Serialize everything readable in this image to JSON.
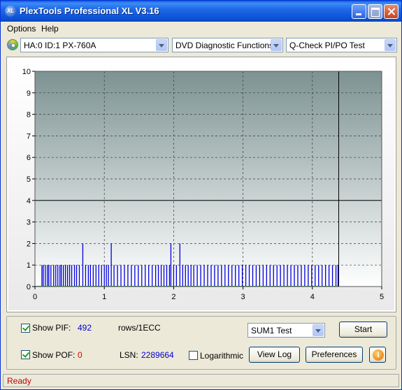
{
  "window": {
    "title": "PlexTools Professional XL V3.16",
    "app_icon_text": "XL"
  },
  "menu": {
    "items": [
      "Options",
      "Help"
    ]
  },
  "toolbar": {
    "drive_select": "HA:0 ID:1  PX-760A",
    "function_select": "DVD Diagnostic Functions",
    "test_select": "Q-Check PI/PO Test"
  },
  "chart_data": {
    "type": "bar",
    "xlim": [
      0,
      5
    ],
    "ylim": [
      0,
      10
    ],
    "x_ticks": [
      "0",
      "1",
      "2",
      "3",
      "4",
      "5"
    ],
    "y_ticks": [
      "0",
      "1",
      "2",
      "3",
      "4",
      "5",
      "6",
      "7",
      "8",
      "9",
      "10"
    ],
    "grid": true,
    "threshold_line_y": 4,
    "end_marker_x": 4.38,
    "colors": {
      "bars": "#0000dd",
      "area_top": "#7d9292",
      "area_bottom": "#ffffff",
      "threshold": "#000000"
    },
    "series": [
      {
        "values": [
          {
            "x": 0.1,
            "y": 1
          },
          {
            "x": 0.12,
            "y": 1
          },
          {
            "x": 0.15,
            "y": 1
          },
          {
            "x": 0.18,
            "y": 1
          },
          {
            "x": 0.2,
            "y": 1
          },
          {
            "x": 0.23,
            "y": 1
          },
          {
            "x": 0.27,
            "y": 1
          },
          {
            "x": 0.3,
            "y": 1
          },
          {
            "x": 0.33,
            "y": 1
          },
          {
            "x": 0.36,
            "y": 1
          },
          {
            "x": 0.38,
            "y": 1
          },
          {
            "x": 0.41,
            "y": 1
          },
          {
            "x": 0.44,
            "y": 1
          },
          {
            "x": 0.47,
            "y": 1
          },
          {
            "x": 0.5,
            "y": 1
          },
          {
            "x": 0.53,
            "y": 1
          },
          {
            "x": 0.57,
            "y": 1
          },
          {
            "x": 0.6,
            "y": 1
          },
          {
            "x": 0.64,
            "y": 1
          },
          {
            "x": 0.69,
            "y": 2
          },
          {
            "x": 0.73,
            "y": 1
          },
          {
            "x": 0.77,
            "y": 1
          },
          {
            "x": 0.8,
            "y": 1
          },
          {
            "x": 0.84,
            "y": 1
          },
          {
            "x": 0.88,
            "y": 1
          },
          {
            "x": 0.92,
            "y": 1
          },
          {
            "x": 0.96,
            "y": 1
          },
          {
            "x": 1.0,
            "y": 1
          },
          {
            "x": 1.03,
            "y": 1
          },
          {
            "x": 1.06,
            "y": 1
          },
          {
            "x": 1.1,
            "y": 2
          },
          {
            "x": 1.14,
            "y": 1
          },
          {
            "x": 1.19,
            "y": 1
          },
          {
            "x": 1.24,
            "y": 1
          },
          {
            "x": 1.29,
            "y": 1
          },
          {
            "x": 1.34,
            "y": 1
          },
          {
            "x": 1.39,
            "y": 1
          },
          {
            "x": 1.44,
            "y": 1
          },
          {
            "x": 1.49,
            "y": 1
          },
          {
            "x": 1.54,
            "y": 1
          },
          {
            "x": 1.59,
            "y": 1
          },
          {
            "x": 1.64,
            "y": 1
          },
          {
            "x": 1.69,
            "y": 1
          },
          {
            "x": 1.74,
            "y": 1
          },
          {
            "x": 1.78,
            "y": 1
          },
          {
            "x": 1.82,
            "y": 1
          },
          {
            "x": 1.86,
            "y": 1
          },
          {
            "x": 1.9,
            "y": 1
          },
          {
            "x": 1.94,
            "y": 1
          },
          {
            "x": 1.96,
            "y": 2
          },
          {
            "x": 2.0,
            "y": 1
          },
          {
            "x": 2.04,
            "y": 1
          },
          {
            "x": 2.09,
            "y": 2
          },
          {
            "x": 2.13,
            "y": 1
          },
          {
            "x": 2.17,
            "y": 1
          },
          {
            "x": 2.21,
            "y": 1
          },
          {
            "x": 2.25,
            "y": 1
          },
          {
            "x": 2.29,
            "y": 1
          },
          {
            "x": 2.34,
            "y": 1
          },
          {
            "x": 2.39,
            "y": 1
          },
          {
            "x": 2.44,
            "y": 1
          },
          {
            "x": 2.49,
            "y": 1
          },
          {
            "x": 2.54,
            "y": 1
          },
          {
            "x": 2.59,
            "y": 1
          },
          {
            "x": 2.64,
            "y": 1
          },
          {
            "x": 2.69,
            "y": 1
          },
          {
            "x": 2.74,
            "y": 1
          },
          {
            "x": 2.79,
            "y": 1
          },
          {
            "x": 2.84,
            "y": 1
          },
          {
            "x": 2.89,
            "y": 1
          },
          {
            "x": 2.94,
            "y": 1
          },
          {
            "x": 2.99,
            "y": 1
          },
          {
            "x": 3.04,
            "y": 1
          },
          {
            "x": 3.09,
            "y": 1
          },
          {
            "x": 3.14,
            "y": 1
          },
          {
            "x": 3.19,
            "y": 1
          },
          {
            "x": 3.24,
            "y": 1
          },
          {
            "x": 3.29,
            "y": 1
          },
          {
            "x": 3.34,
            "y": 1
          },
          {
            "x": 3.39,
            "y": 1
          },
          {
            "x": 3.44,
            "y": 1
          },
          {
            "x": 3.49,
            "y": 1
          },
          {
            "x": 3.54,
            "y": 1
          },
          {
            "x": 3.59,
            "y": 1
          },
          {
            "x": 3.64,
            "y": 1
          },
          {
            "x": 3.69,
            "y": 1
          },
          {
            "x": 3.74,
            "y": 1
          },
          {
            "x": 3.79,
            "y": 1
          },
          {
            "x": 3.84,
            "y": 1
          },
          {
            "x": 3.89,
            "y": 1
          },
          {
            "x": 3.94,
            "y": 1
          },
          {
            "x": 3.99,
            "y": 1
          },
          {
            "x": 4.04,
            "y": 1
          },
          {
            "x": 4.09,
            "y": 1
          },
          {
            "x": 4.14,
            "y": 1
          },
          {
            "x": 4.19,
            "y": 1
          },
          {
            "x": 4.24,
            "y": 1
          },
          {
            "x": 4.29,
            "y": 1
          },
          {
            "x": 4.34,
            "y": 1
          },
          {
            "x": 4.37,
            "y": 1
          }
        ]
      }
    ]
  },
  "controls": {
    "show_pif_label": "Show PIF:",
    "show_pif_checked": true,
    "pif_value": "492",
    "rows_label": "rows/1ECC",
    "show_pof_label": "Show POF:",
    "show_pof_checked": true,
    "pof_value": "0",
    "lsn_label": "LSN:",
    "lsn_value": "2289664",
    "logarithmic_label": "Logarithmic",
    "logarithmic_checked": false,
    "sum_select": "SUM1 Test",
    "start_button": "Start",
    "view_log_button": "View Log",
    "preferences_button": "Preferences",
    "info_button_glyph": "i"
  },
  "status": {
    "text": "Ready"
  }
}
